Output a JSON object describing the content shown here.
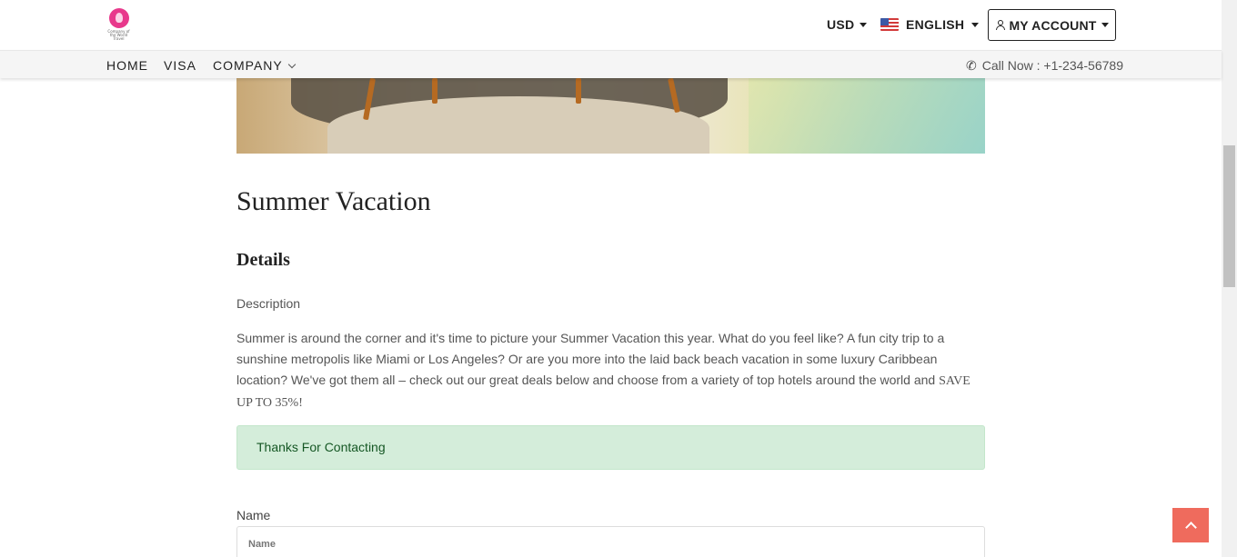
{
  "header": {
    "logo_alt": "Company logo",
    "logo_tagline": "Company of the World Travel",
    "currency": "USD",
    "language": "ENGLISH",
    "account_label": "MY ACCOUNT"
  },
  "nav": {
    "items": [
      {
        "label": "HOME"
      },
      {
        "label": "VISA"
      },
      {
        "label": "COMPANY"
      }
    ],
    "call_text": "Call Now : +1-234-56789"
  },
  "content": {
    "title": "Summer Vacation",
    "subtitle": "Details",
    "description_label": "Description",
    "description_main": "Summer is around the corner and it's time to picture your Summer Vacation this year. What do you feel like? A fun city trip to a sunshine metropolis like Miami or Los Angeles? Or are you more into the laid back beach vacation in some luxury Caribbean location? We've got them all – check out our great deals below and choose from a variety of top hotels around the world and ",
    "description_emph": "SAVE UP TO 35%!",
    "alert_text": "Thanks For Contacting"
  },
  "form": {
    "name_label": "Name",
    "name_placeholder": "Name",
    "name_value": ""
  },
  "colors": {
    "alert_bg": "#d4edda",
    "alert_text": "#155724",
    "back_to_top": "#ef6b5d",
    "logo": "#e8398c"
  },
  "icons": {
    "currency_caret": "caret-down-icon",
    "language_flag": "us-flag-icon",
    "account": "user-icon",
    "company_chevron": "chevron-down-icon",
    "phone": "phone-icon",
    "back_to_top": "arrow-up-icon"
  }
}
